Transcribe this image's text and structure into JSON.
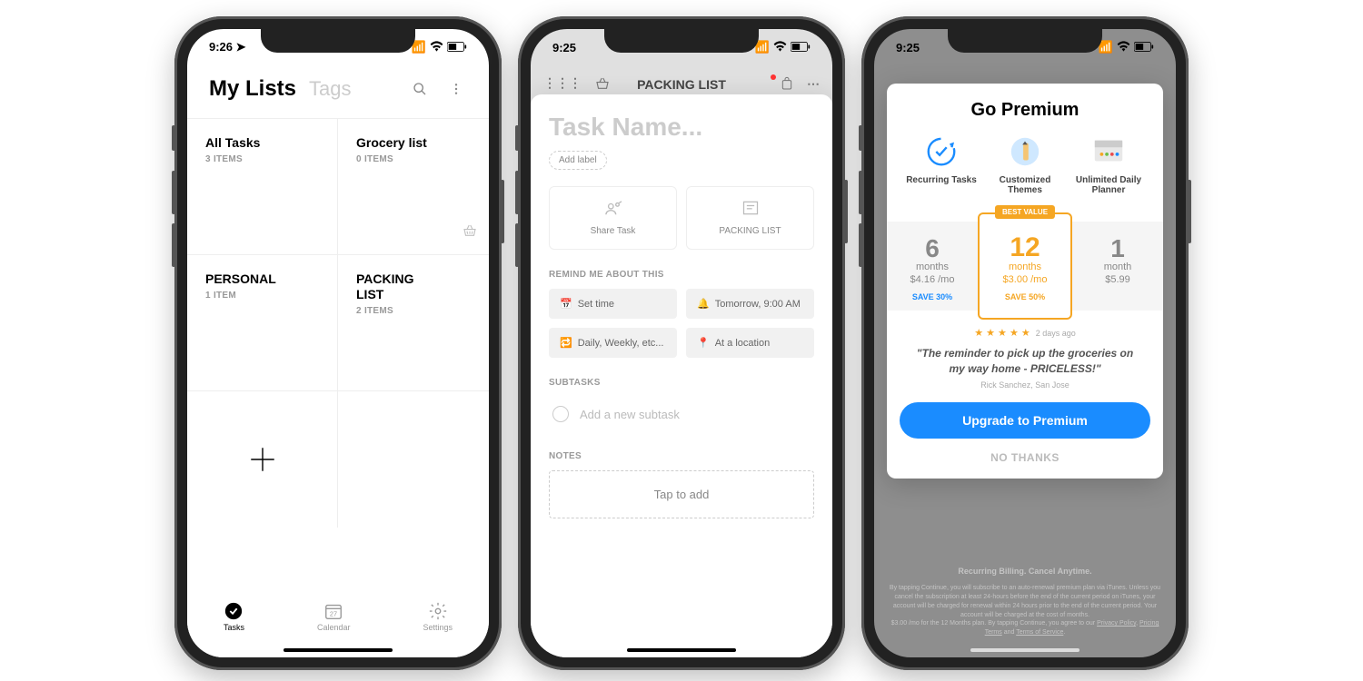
{
  "status": {
    "time1": "9:26",
    "time2": "9:25",
    "time3": "9:25"
  },
  "phone1": {
    "tabs": {
      "active": "My Lists",
      "inactive": "Tags"
    },
    "lists": [
      {
        "name": "All Tasks",
        "count": "3 ITEMS"
      },
      {
        "name": "Grocery list",
        "count": "0 ITEMS"
      },
      {
        "name": "PERSONAL",
        "count": "1 ITEM"
      },
      {
        "name": "PACKING LIST",
        "count": "2 ITEMS"
      }
    ],
    "nav": {
      "tasks": "Tasks",
      "calendar": "Calendar",
      "calendar_day": "27",
      "settings": "Settings"
    }
  },
  "phone2": {
    "header_title": "PACKING LIST",
    "task_placeholder": "Task Name...",
    "add_label": "Add label",
    "share": "Share Task",
    "list_name": "PACKING LIST",
    "remind_header": "REMIND ME ABOUT THIS",
    "reminders": {
      "set_time": "Set time",
      "tomorrow": "Tomorrow, 9:00 AM",
      "repeat": "Daily, Weekly, etc...",
      "location": "At a location"
    },
    "subtasks_header": "SUBTASKS",
    "subtask_placeholder": "Add a new subtask",
    "notes_header": "NOTES",
    "notes_placeholder": "Tap to add"
  },
  "phone3": {
    "title": "Go Premium",
    "features": [
      {
        "name": "Recurring Tasks"
      },
      {
        "name": "Customized Themes"
      },
      {
        "name": "Unlimited Daily Planner"
      }
    ],
    "badge": "BEST VALUE",
    "plans": [
      {
        "num": "6",
        "unit": "months",
        "price": "$4.16 /mo",
        "save": "SAVE 30%"
      },
      {
        "num": "12",
        "unit": "months",
        "price": "$3.00 /mo",
        "save": "SAVE 50%"
      },
      {
        "num": "1",
        "unit": "month",
        "price": "$5.99",
        "save": ""
      }
    ],
    "review_when": "2 days ago",
    "quote": "\"The reminder to pick up the groceries on my way home - PRICELESS!\"",
    "author": "Rick Sanchez, San Jose",
    "cta": "Upgrade to Premium",
    "nothanks": "NO THANKS",
    "legal_header": "Recurring Billing. Cancel Anytime.",
    "legal_body": "By tapping Continue, you will subscribe to an auto-renewal premium plan via iTunes. Unless you cancel the subscription at least 24-hours before the end of the current period on iTunes, your account will be charged for renewal within 24 hours prior to the end of the current period. Your account will be charged at the cost of months.",
    "legal_body2": "$3.00 /mo for the 12 Months plan. By tapping Continue, you agree to our ",
    "privacy": "Privacy Policy",
    "pricing": "Pricing Terms",
    "and": " and ",
    "tos": "Terms of Service"
  }
}
